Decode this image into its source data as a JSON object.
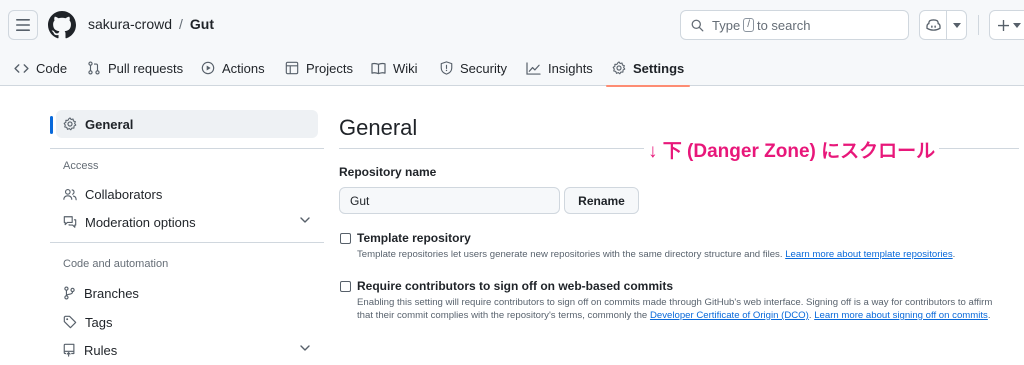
{
  "header": {
    "owner": "sakura-crowd",
    "separator": "/",
    "repo": "Gut",
    "search": {
      "prefix": "Type",
      "key": "/",
      "suffix": "to search"
    }
  },
  "repo_nav": {
    "tabs": [
      {
        "label": "Code",
        "icon": "code-icon"
      },
      {
        "label": "Pull requests",
        "icon": "pull-request-icon"
      },
      {
        "label": "Actions",
        "icon": "play-icon"
      },
      {
        "label": "Projects",
        "icon": "table-icon"
      },
      {
        "label": "Wiki",
        "icon": "book-icon"
      },
      {
        "label": "Security",
        "icon": "shield-icon"
      },
      {
        "label": "Insights",
        "icon": "graph-icon"
      },
      {
        "label": "Settings",
        "icon": "gear-icon",
        "selected": true
      }
    ]
  },
  "sidebar": {
    "general": "General",
    "sections": [
      {
        "heading": "Access",
        "items": [
          {
            "label": "Collaborators",
            "icon": "people-icon"
          },
          {
            "label": "Moderation options",
            "icon": "comment-discussion-icon",
            "expandable": true
          }
        ]
      },
      {
        "heading": "Code and automation",
        "items": [
          {
            "label": "Branches",
            "icon": "git-branch-icon"
          },
          {
            "label": "Tags",
            "icon": "tag-icon"
          },
          {
            "label": "Rules",
            "icon": "repo-push-icon",
            "expandable": true
          }
        ]
      }
    ]
  },
  "main": {
    "title": "General",
    "annotation": "↓ 下 (Danger Zone) にスクロール",
    "repo_name": {
      "label": "Repository name",
      "value": "Gut",
      "rename_button": "Rename"
    },
    "template_repository": {
      "title": "Template repository",
      "checked": false,
      "description": "Template repositories let users generate new repositories with the same directory structure and files.",
      "link": "Learn more about template repositories"
    },
    "signoff": {
      "title": "Require contributors to sign off on web-based commits",
      "checked": false,
      "description": "Enabling this setting will require contributors to sign off on commits made through GitHub's web interface. Signing off is a way for contributors to affirm that their commit complies with the repository's terms, commonly the",
      "link1": "Developer Certificate of Origin (DCO)",
      "link2": "Learn more about signing off on commits"
    }
  },
  "colors": {
    "accent": "#0969da",
    "selected_tab_underline": "#fd8c73",
    "annotation": "#e8177a"
  }
}
